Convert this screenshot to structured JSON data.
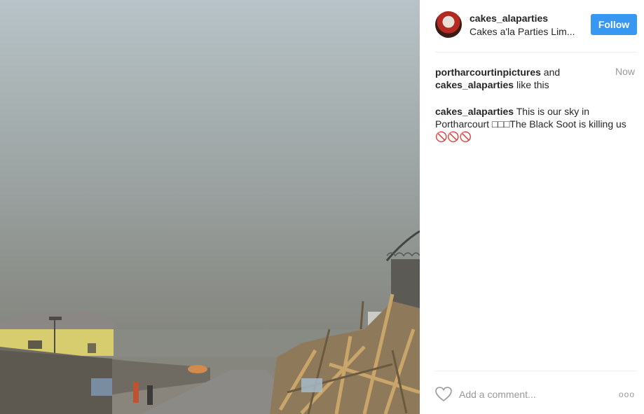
{
  "header": {
    "username": "cakes_alaparties",
    "full_name": "Cakes a'la Parties Lim...",
    "follow_label": "Follow"
  },
  "likes": {
    "user1": "portharcourtinpictures",
    "conj": " and ",
    "user2": "cakes_alaparties",
    "suffix": " like this",
    "time": "Now"
  },
  "caption": {
    "user": "cakes_alaparties",
    "text": " This is our sky in Portharcourt □□□The Black Soot is killing us",
    "emoji": "🚫🚫🚫"
  },
  "comment": {
    "placeholder": "Add a comment...",
    "more_label": "ooo"
  },
  "colors": {
    "follow_bg": "#3897f0",
    "text": "#262626",
    "muted": "#999999"
  },
  "icons": [
    "heart-icon",
    "more-options-icon",
    "avatar"
  ]
}
